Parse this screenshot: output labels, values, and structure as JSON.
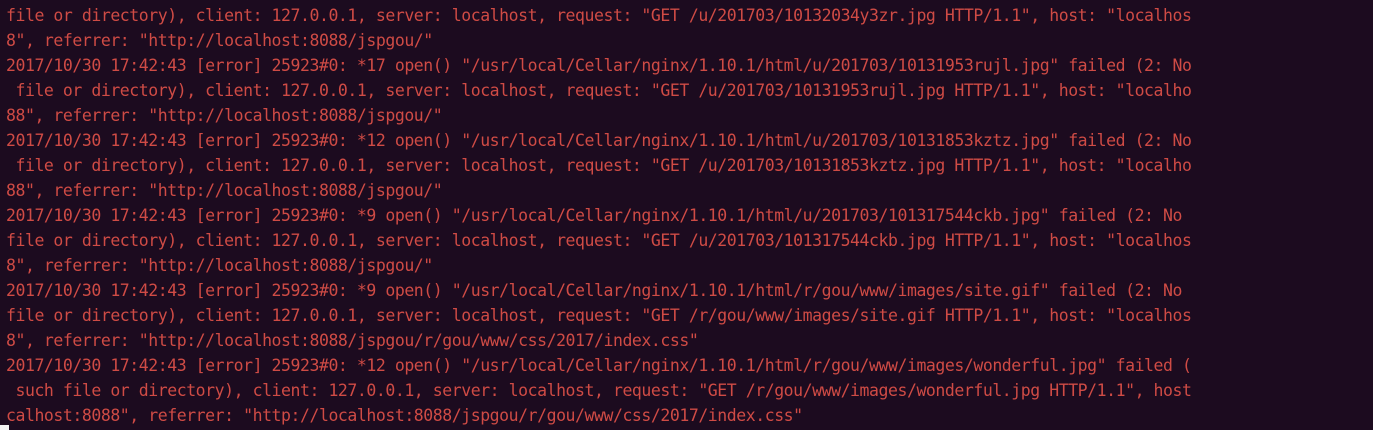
{
  "theme": {
    "background": "#1c0b1f",
    "error_text": "#cf4b45",
    "cursor": "#f2f2f2"
  },
  "terminal": {
    "lines": [
      "file or directory), client: 127.0.0.1, server: localhost, request: \"GET /u/201703/10132034y3zr.jpg HTTP/1.1\", host: \"localhos",
      "8\", referrer: \"http://localhost:8088/jspgou/\"",
      "2017/10/30 17:42:43 [error] 25923#0: *17 open() \"/usr/local/Cellar/nginx/1.10.1/html/u/201703/10131953rujl.jpg\" failed (2: No",
      " file or directory), client: 127.0.0.1, server: localhost, request: \"GET /u/201703/10131953rujl.jpg HTTP/1.1\", host: \"localho",
      "88\", referrer: \"http://localhost:8088/jspgou/\"",
      "2017/10/30 17:42:43 [error] 25923#0: *12 open() \"/usr/local/Cellar/nginx/1.10.1/html/u/201703/10131853kztz.jpg\" failed (2: No",
      " file or directory), client: 127.0.0.1, server: localhost, request: \"GET /u/201703/10131853kztz.jpg HTTP/1.1\", host: \"localho",
      "88\", referrer: \"http://localhost:8088/jspgou/\"",
      "2017/10/30 17:42:43 [error] 25923#0: *9 open() \"/usr/local/Cellar/nginx/1.10.1/html/u/201703/101317544ckb.jpg\" failed (2: No",
      "file or directory), client: 127.0.0.1, server: localhost, request: \"GET /u/201703/101317544ckb.jpg HTTP/1.1\", host: \"localhos",
      "8\", referrer: \"http://localhost:8088/jspgou/\"",
      "2017/10/30 17:42:43 [error] 25923#0: *9 open() \"/usr/local/Cellar/nginx/1.10.1/html/r/gou/www/images/site.gif\" failed (2: No",
      "file or directory), client: 127.0.0.1, server: localhost, request: \"GET /r/gou/www/images/site.gif HTTP/1.1\", host: \"localhos",
      "8\", referrer: \"http://localhost:8088/jspgou/r/gou/www/css/2017/index.css\"",
      "2017/10/30 17:42:43 [error] 25923#0: *12 open() \"/usr/local/Cellar/nginx/1.10.1/html/r/gou/www/images/wonderful.jpg\" failed (",
      " such file or directory), client: 127.0.0.1, server: localhost, request: \"GET /r/gou/www/images/wonderful.jpg HTTP/1.1\", host",
      "calhost:8088\", referrer: \"http://localhost:8088/jspgou/r/gou/www/css/2017/index.css\""
    ]
  }
}
